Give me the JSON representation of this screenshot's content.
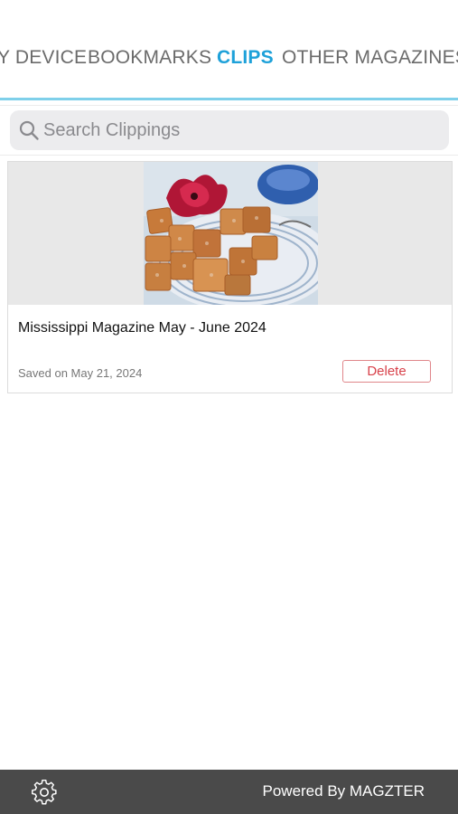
{
  "tabs": [
    {
      "label": "Y DEVICE",
      "active": false
    },
    {
      "label": "BOOKMARKS",
      "active": false
    },
    {
      "label": "CLIPS",
      "active": true
    },
    {
      "label": "OTHER MAGAZINES",
      "active": false
    }
  ],
  "colors": {
    "accent": "#1ea1d9",
    "delete": "#d8414a",
    "footer": "#4a4a4a"
  },
  "search": {
    "placeholder": "Search Clippings",
    "value": "",
    "icon": "search-icon"
  },
  "clips": [
    {
      "image": "clip-thumbnail-food",
      "title": "Mississippi Magazine May - June 2024",
      "saved": "Saved on May 21, 2024",
      "delete_label": "Delete"
    }
  ],
  "footer": {
    "settings_icon": "gear-icon",
    "powered_by": "Powered By MAGZTER"
  }
}
